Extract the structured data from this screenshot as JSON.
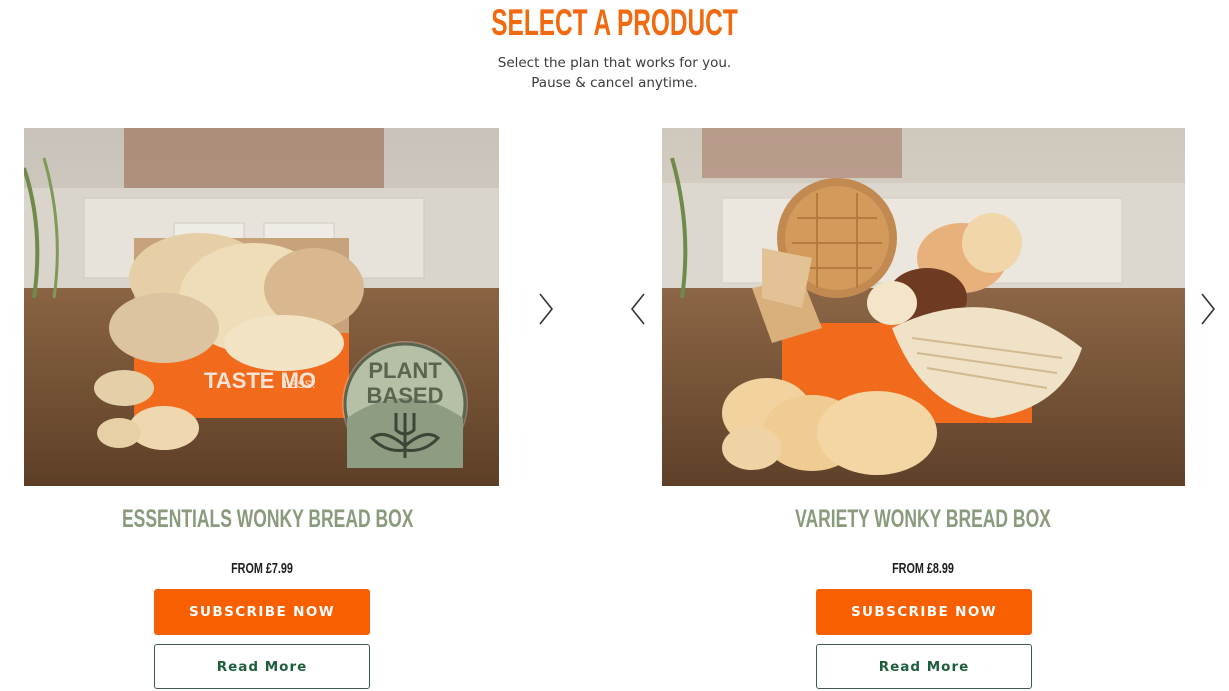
{
  "header": {
    "title": "SELECT A PRODUCT",
    "subtitle_line1": "Select the plan that works for you.",
    "subtitle_line2": "Pause & cancel anytime."
  },
  "products": [
    {
      "name": "ESSENTIALS WONKY BREAD BOX",
      "price": "FROM £7.99",
      "subscribe_label": "SUBSCRIBE NOW",
      "read_more_label": "Read More",
      "badge_line1": "PLANT",
      "badge_line2": "BASED",
      "box_text": "TASTE MO",
      "box_text_2": "LESS."
    },
    {
      "name": "VARIETY WONKY BREAD BOX",
      "price": "FROM £8.99",
      "subscribe_label": "SUBSCRIBE NOW",
      "read_more_label": "Read More"
    }
  ],
  "colors": {
    "brand_orange": "#f75f00",
    "title_orange": "#f26a10",
    "product_name_green": "#8a9a7c",
    "read_more_green": "#1f5e3c"
  },
  "icons": {
    "next": "chevron-right-icon",
    "prev": "chevron-left-icon",
    "badge": "plant-fork-icon"
  }
}
